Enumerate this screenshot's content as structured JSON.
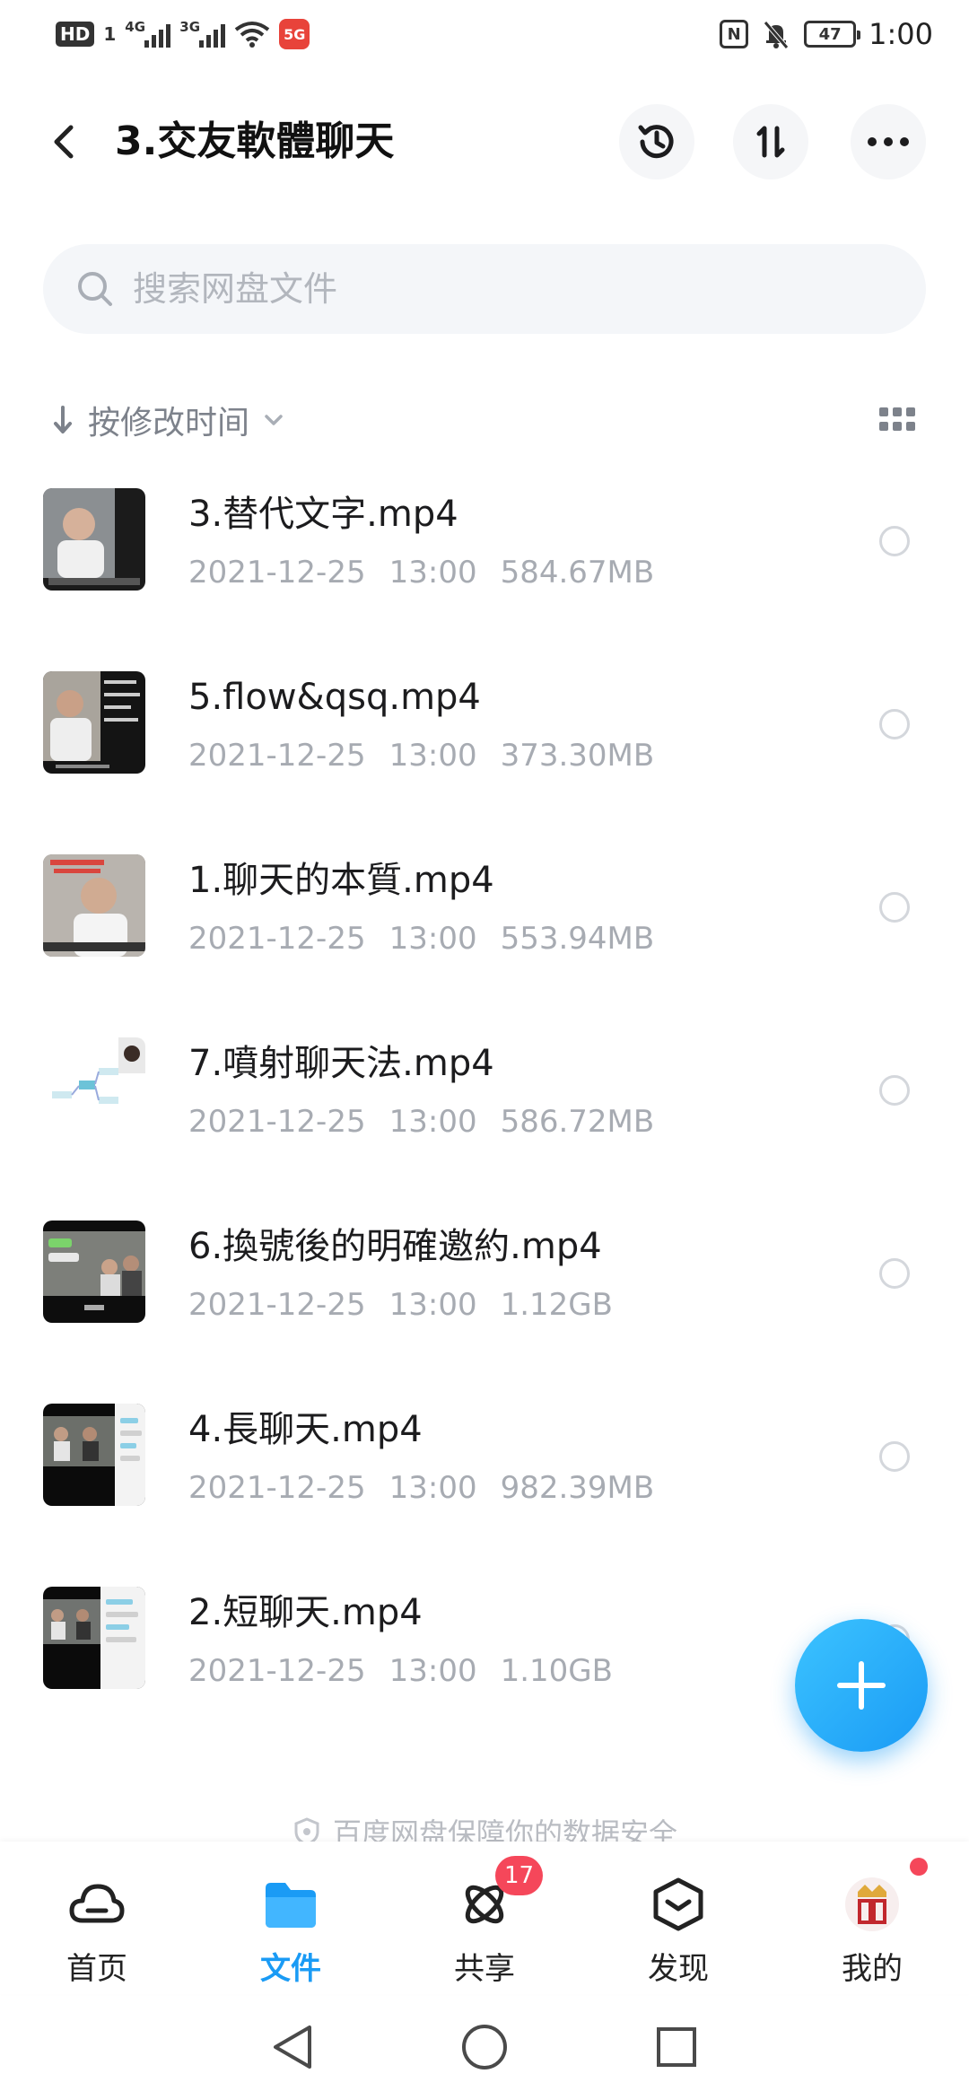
{
  "status_bar": {
    "hd": "HD",
    "sim": "1",
    "net1": "4G",
    "net2": "3G",
    "app_icon_text": "5G",
    "nfc": "N",
    "battery": "47",
    "time": "1:00"
  },
  "header": {
    "title": "3.交友軟體聊天"
  },
  "search": {
    "placeholder": "搜索网盘文件"
  },
  "sort": {
    "label": "按修改时间"
  },
  "files": [
    {
      "name": "3.替代文字.mp4",
      "date": "2021-12-25",
      "time": "13:00",
      "size": "584.67MB"
    },
    {
      "name": "5.flow&qsq.mp4",
      "date": "2021-12-25",
      "time": "13:00",
      "size": "373.30MB"
    },
    {
      "name": "1.聊天的本質.mp4",
      "date": "2021-12-25",
      "time": "13:00",
      "size": "553.94MB"
    },
    {
      "name": "7.噴射聊天法.mp4",
      "date": "2021-12-25",
      "time": "13:00",
      "size": "586.72MB"
    },
    {
      "name": "6.換號後的明確邀約.mp4",
      "date": "2021-12-25",
      "time": "13:00",
      "size": "1.12GB"
    },
    {
      "name": "4.長聊天.mp4",
      "date": "2021-12-25",
      "time": "13:00",
      "size": "982.39MB"
    },
    {
      "name": "2.短聊天.mp4",
      "date": "2021-12-25",
      "time": "13:00",
      "size": "1.10GB"
    }
  ],
  "footer": {
    "safe_note": "百度网盘保障你的数据安全"
  },
  "tabs": [
    {
      "label": "首页"
    },
    {
      "label": "文件"
    },
    {
      "label": "共享",
      "badge": "17"
    },
    {
      "label": "发现"
    },
    {
      "label": "我的"
    }
  ],
  "colors": {
    "accent": "#1a9bf5",
    "badge": "#f5475a",
    "meta_text": "#a7abb2"
  }
}
